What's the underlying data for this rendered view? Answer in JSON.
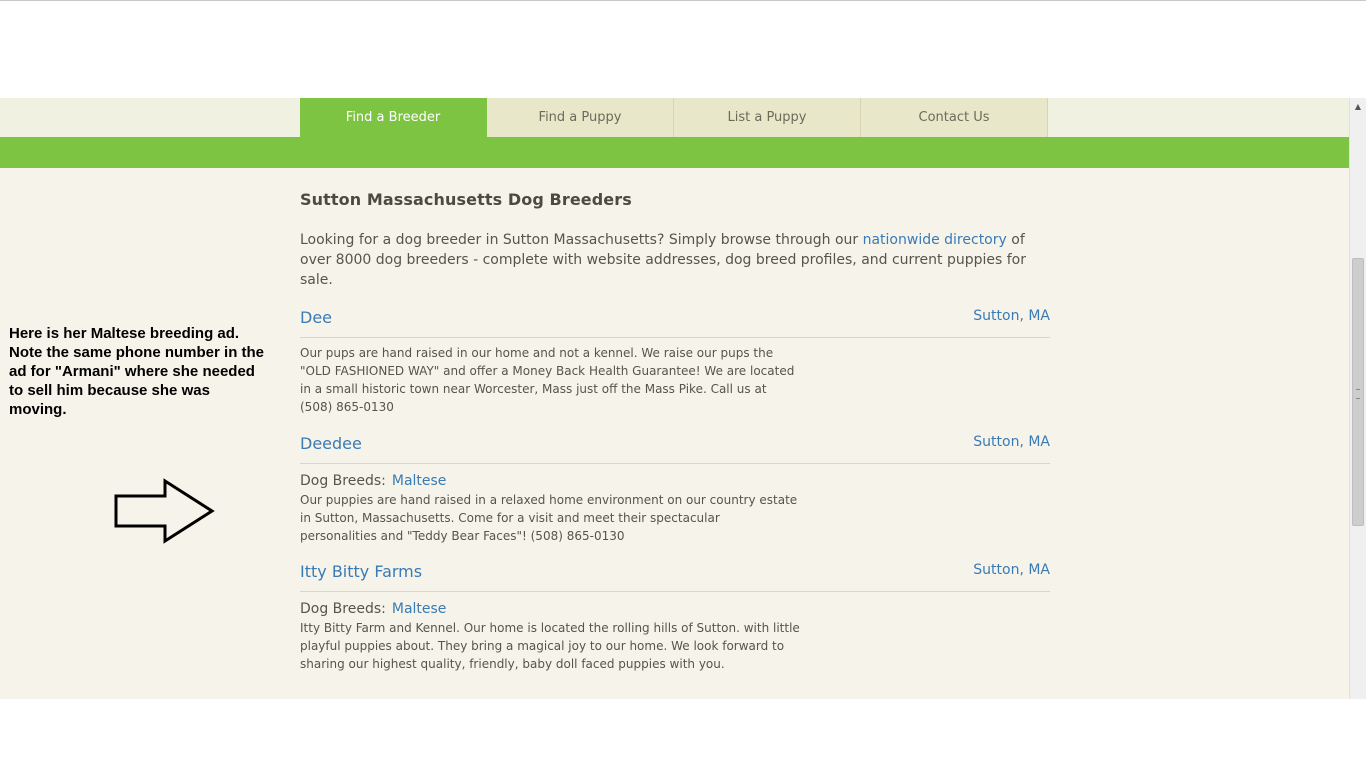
{
  "nav": {
    "tabs": [
      {
        "label": "Find a Breeder",
        "active": true
      },
      {
        "label": "Find a Puppy",
        "active": false
      },
      {
        "label": "List a Puppy",
        "active": false
      },
      {
        "label": "Contact Us",
        "active": false
      }
    ]
  },
  "main": {
    "title": "Sutton Massachusetts Dog Breeders",
    "intro": {
      "before": "Looking for a dog breeder in Sutton Massachusetts? Simply browse through our ",
      "link": "nationwide directory",
      "after": " of over 8000 dog breeders - complete with website addresses, dog breed profiles, and current puppies for sale."
    },
    "listings": [
      {
        "name": "Dee",
        "location": "Sutton, MA",
        "breeds_label": "",
        "breed": "",
        "description": "Our pups are hand raised in our home and not a kennel. We raise our pups the \"OLD FASHIONED WAY\" and offer a Money Back Health Guarantee! We are located in a small historic town near Worcester, Mass just off the Mass Pike. Call us at (508) 865-0130"
      },
      {
        "name": "Deedee",
        "location": "Sutton, MA",
        "breeds_label": "Dog Breeds:",
        "breed": "Maltese",
        "description": "Our puppies are hand raised in a relaxed home environment on our country estate in Sutton, Massachusetts. Come for a visit and meet their spectacular personalities and \"Teddy Bear Faces\"! (508) 865-0130"
      },
      {
        "name": "Itty Bitty Farms",
        "location": "Sutton, MA",
        "breeds_label": "Dog Breeds:",
        "breed": "Maltese",
        "description": "Itty Bitty Farm and Kennel. Our home is located the rolling hills of Sutton. with little playful puppies about. They bring a magical joy to our home. We look forward to sharing our highest quality, friendly, baby doll faced puppies with you."
      }
    ]
  },
  "annotation": {
    "text": "Here is her Maltese breeding ad. Note the same phone number in the ad for \"Armani\" where she needed to sell him because she was moving."
  },
  "icons": {
    "arrow": "right-arrow-icon",
    "scroll_up": "scroll-up-icon"
  },
  "colors": {
    "accent_green": "#7dc443",
    "link_blue": "#3a7ab5",
    "page_bg": "#f6f4ea"
  }
}
